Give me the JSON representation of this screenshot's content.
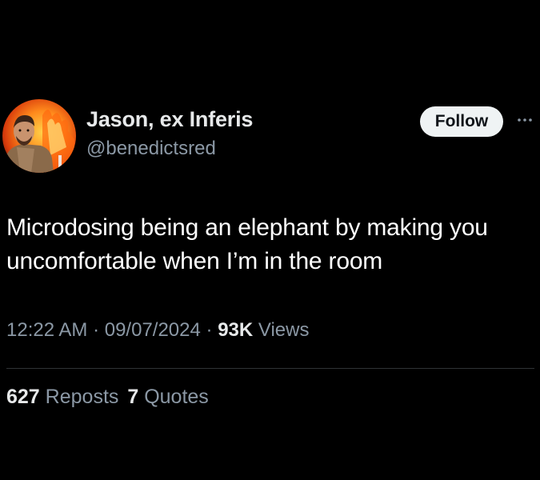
{
  "author": {
    "display_name": "Jason, ex Inferis",
    "handle": "@benedictsred",
    "avatar_icon": "user-avatar-fire"
  },
  "follow_button": {
    "label": "Follow"
  },
  "more_icon": "more-horizontal-icon",
  "tweet": {
    "text": "Microdosing being an elephant by making you uncomfortable when I’m in the room"
  },
  "meta": {
    "time": "12:22 AM",
    "separator_1": " · ",
    "date": "09/07/2024",
    "separator_2": " · ",
    "views_count": "93K",
    "views_label": " Views"
  },
  "stats": {
    "reposts_count": "627",
    "reposts_label": "Reposts",
    "quotes_count": "7",
    "quotes_label": "Quotes"
  },
  "colors": {
    "background": "#000000",
    "primary_text": "#e7e9ea",
    "secondary_text": "#8b98a5",
    "button_bg": "#eff3f4",
    "divider": "#2f3336"
  }
}
